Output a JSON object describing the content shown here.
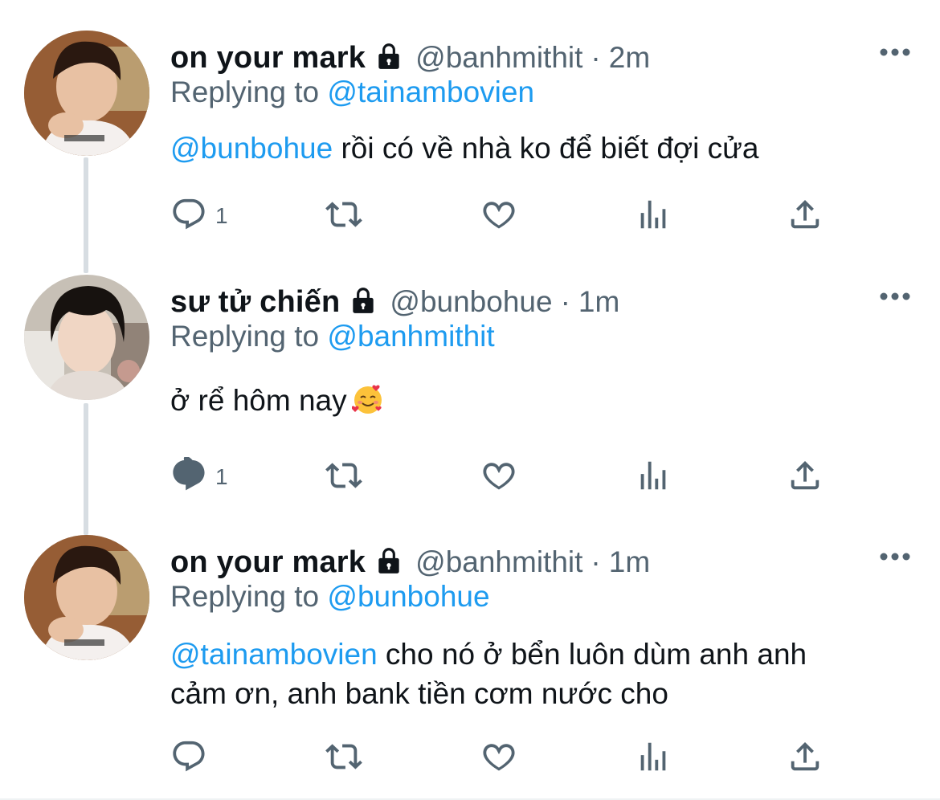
{
  "tweets": [
    {
      "name": "on your mark",
      "handle": "@banhmithit",
      "sep": "·",
      "time": "2m",
      "replying_prefix": "Replying to",
      "replying_to": "@tainambovien",
      "mention": "@bunbohue",
      "text": " rồi có về nhà ko để biết đợi cửa",
      "reply_count": "1"
    },
    {
      "name": "sư tử chiến",
      "handle": "@bunbohue",
      "sep": "·",
      "time": "1m",
      "replying_prefix": "Replying to",
      "replying_to": "@banhmithit",
      "mention": "",
      "text": "ở rể hôm nay",
      "emoji": "smiling-face-with-hearts",
      "reply_count": "1"
    },
    {
      "name": "on your mark",
      "handle": "@banhmithit",
      "sep": "·",
      "time": "1m",
      "replying_prefix": "Replying to",
      "replying_to": "@bunbohue",
      "mention": "@tainambovien",
      "text_line1": " cho nó ở bển luôn dùm anh anh",
      "text_line2": "cảm ơn, anh bank tiền cơm nước cho",
      "reply_count": ""
    }
  ],
  "icons": {
    "reply": "reply-icon",
    "retweet": "retweet-icon",
    "like": "heart-icon",
    "views": "analytics-icon",
    "share": "share-icon",
    "more": "more-dots-icon",
    "lock": "lock-icon"
  },
  "colors": {
    "text": "#0f1419",
    "secondary": "#536471",
    "link": "#1d9bf0",
    "thread_line": "#d7dde2"
  }
}
